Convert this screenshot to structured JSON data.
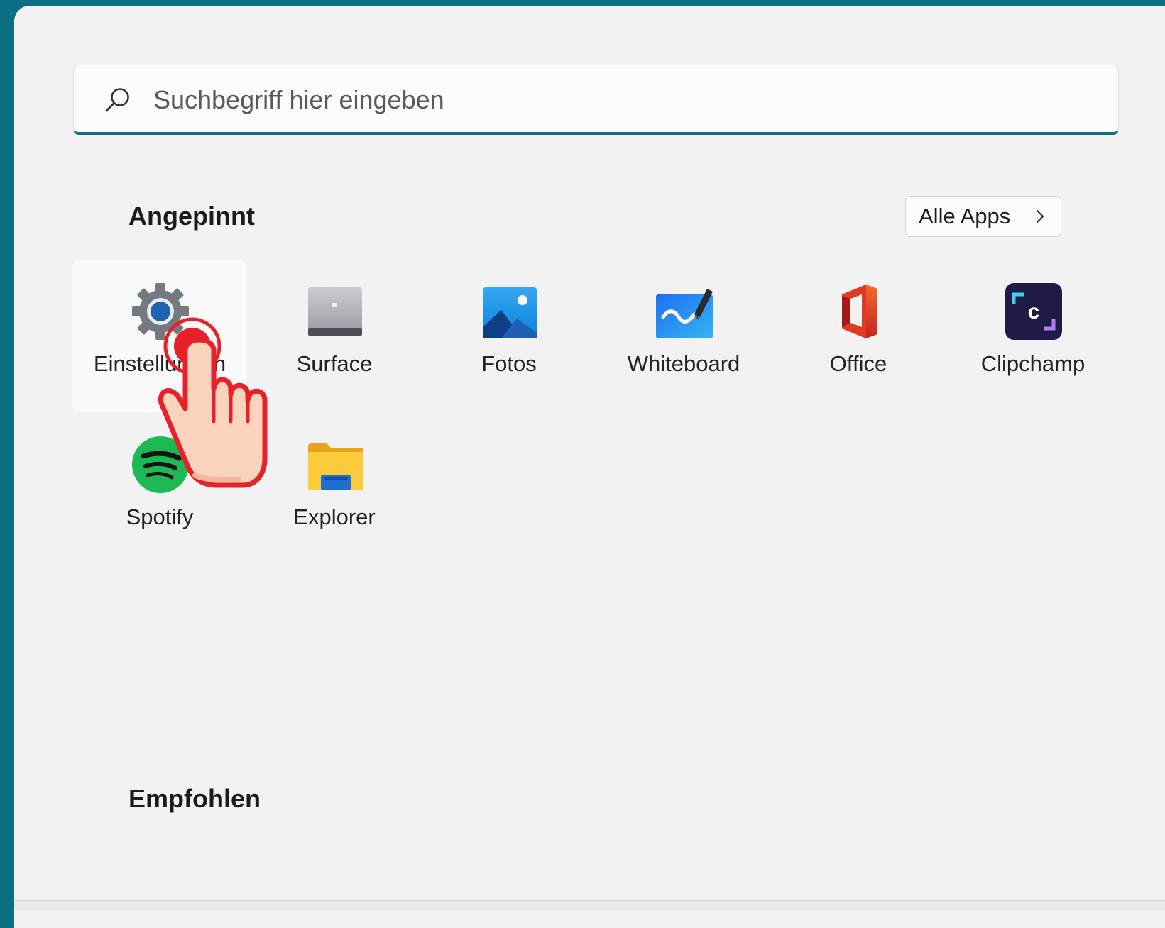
{
  "search": {
    "placeholder": "Suchbegriff hier eingeben"
  },
  "pinned": {
    "title": "Angepinnt",
    "all_apps_label": "Alle Apps",
    "apps": [
      {
        "label": "Einstellungen",
        "icon": "gear-icon"
      },
      {
        "label": "Surface",
        "icon": "surface-icon"
      },
      {
        "label": "Fotos",
        "icon": "photos-icon"
      },
      {
        "label": "Whiteboard",
        "icon": "whiteboard-icon"
      },
      {
        "label": "Office",
        "icon": "office-icon"
      },
      {
        "label": "Clipchamp",
        "icon": "clipchamp-icon"
      },
      {
        "label": "Spotify",
        "icon": "spotify-icon"
      },
      {
        "label": "Explorer",
        "icon": "folder-icon"
      }
    ]
  },
  "recommended": {
    "title": "Empfohlen"
  },
  "colors": {
    "accent": "#0f6d82",
    "background": "#0b6f84",
    "panel": "#f2f2f2",
    "pointer_red": "#e8202a"
  }
}
